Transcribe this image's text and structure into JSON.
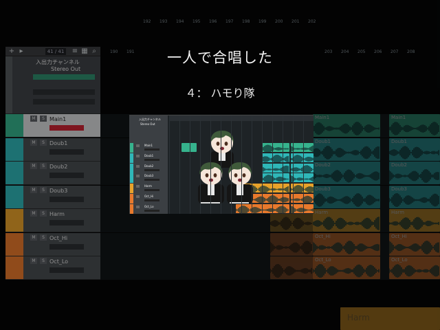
{
  "title": "一人で合唱した",
  "subtitle": "４： ハモり隊",
  "daw": {
    "counter": "41 / 41",
    "ruler": [
      "190",
      "191",
      "192",
      "193",
      "194",
      "195",
      "196",
      "197",
      "198",
      "199",
      "200",
      "201",
      "202",
      "203",
      "204",
      "205",
      "206",
      "207",
      "208"
    ],
    "header_track": "入出力チャンネル",
    "header_output": "Stereo Out",
    "tracks": [
      {
        "name": "Main1",
        "color": "#36b38d"
      },
      {
        "name": "Doub1",
        "color": "#2fb7b8"
      },
      {
        "name": "Doub2",
        "color": "#2fb7b8"
      },
      {
        "name": "Doub3",
        "color": "#2fb7b8"
      },
      {
        "name": "Harm",
        "color": "#e8a22a"
      },
      {
        "name": "Oct_Hi",
        "color": "#e8792c"
      },
      {
        "name": "Oct_Lo",
        "color": "#e8792c"
      }
    ],
    "regions_right": [
      "Main1",
      "Doub1",
      "Doub2",
      "Doub3",
      "Harm",
      "Oct_Hi",
      "Oct_Lo"
    ],
    "regions_far": [
      "Main1",
      "Doub1",
      "Doub2",
      "Doub3",
      "Harm",
      "Oct_Hi",
      "Oct_Lo"
    ],
    "bottom_region": "Harm",
    "mute_label": "M",
    "solo_label": "S",
    "read_label": "R"
  },
  "screen": {
    "header": "入出力チャンネル",
    "output": "Stereo Out",
    "tracks": [
      "Main1",
      "Doub1",
      "Doub2",
      "Doub3",
      "Harm",
      "Oct_Hi",
      "Oct_Lo"
    ]
  },
  "colors": {
    "green": "#36b38d",
    "teal": "#2fb7b8",
    "yellow": "#e8a22a",
    "orange": "#e8792c",
    "hair": "#3f5a3a",
    "jacket": "#141414"
  }
}
